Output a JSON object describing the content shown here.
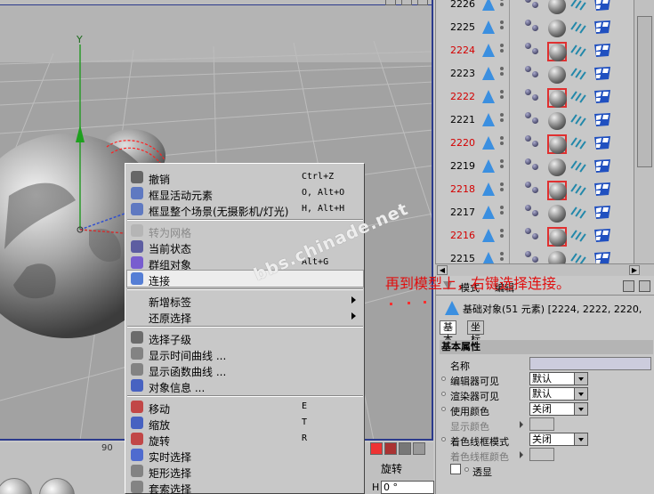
{
  "viewport": {
    "axis_y_label": "Y",
    "coord_readout": "90"
  },
  "object_list": {
    "rows": [
      {
        "num": "2226",
        "red": false,
        "selected": false
      },
      {
        "num": "2225",
        "red": false,
        "selected": false
      },
      {
        "num": "2224",
        "red": true,
        "selected": true
      },
      {
        "num": "2223",
        "red": false,
        "selected": false
      },
      {
        "num": "2222",
        "red": true,
        "selected": true
      },
      {
        "num": "2221",
        "red": false,
        "selected": false
      },
      {
        "num": "2220",
        "red": true,
        "selected": true
      },
      {
        "num": "2219",
        "red": false,
        "selected": false
      },
      {
        "num": "2218",
        "red": true,
        "selected": true
      },
      {
        "num": "2217",
        "red": false,
        "selected": false
      },
      {
        "num": "2216",
        "red": true,
        "selected": true
      },
      {
        "num": "2215",
        "red": false,
        "selected": false
      }
    ]
  },
  "context_menu": {
    "items": [
      {
        "label": "撤销",
        "shortcut": "Ctrl+Z",
        "icon": "undo-icon",
        "dim": false,
        "submenu": false
      },
      {
        "label": "框显活动元素",
        "shortcut": "O, Alt+O",
        "icon": "frame-active-icon",
        "dim": false,
        "submenu": false
      },
      {
        "label": "框显整个场景(无摄影机/灯光)",
        "shortcut": "H, Alt+H",
        "icon": "frame-scene-icon",
        "dim": false,
        "submenu": false
      },
      {
        "label": "转为网格",
        "shortcut": "",
        "icon": "convert-mesh-icon",
        "dim": true,
        "submenu": false
      },
      {
        "label": "当前状态",
        "shortcut": "",
        "icon": "current-state-icon",
        "dim": false,
        "submenu": false
      },
      {
        "label": "群组对象",
        "shortcut": "Alt+G",
        "icon": "group-icon",
        "dim": false,
        "submenu": false
      },
      {
        "label": "连接",
        "shortcut": "",
        "icon": "connect-icon",
        "dim": false,
        "submenu": false,
        "highlight": true
      },
      {
        "label": "新增标签",
        "shortcut": "",
        "icon": "",
        "dim": false,
        "submenu": true
      },
      {
        "label": "还原选择",
        "shortcut": "",
        "icon": "",
        "dim": false,
        "submenu": true
      },
      {
        "label": "选择子级",
        "shortcut": "",
        "icon": "select-children-icon",
        "dim": false,
        "submenu": false
      },
      {
        "label": "显示时间曲线 ...",
        "shortcut": "",
        "icon": "time-curve-icon",
        "dim": false,
        "submenu": false
      },
      {
        "label": "显示函数曲线 ...",
        "shortcut": "",
        "icon": "function-curve-icon",
        "dim": false,
        "submenu": false
      },
      {
        "label": "对象信息 ...",
        "shortcut": "",
        "icon": "object-info-icon",
        "dim": false,
        "submenu": false
      },
      {
        "label": "移动",
        "shortcut": "E",
        "icon": "move-icon",
        "dim": false,
        "submenu": false
      },
      {
        "label": "缩放",
        "shortcut": "T",
        "icon": "scale-icon",
        "dim": false,
        "submenu": false
      },
      {
        "label": "旋转",
        "shortcut": "R",
        "icon": "rotate-icon",
        "dim": false,
        "submenu": false
      },
      {
        "label": "实时选择",
        "shortcut": "",
        "icon": "live-select-icon",
        "dim": false,
        "submenu": false
      },
      {
        "label": "矩形选择",
        "shortcut": "",
        "icon": "rect-select-icon",
        "dim": false,
        "submenu": false
      },
      {
        "label": "套索选择",
        "shortcut": "",
        "icon": "lasso-select-icon",
        "dim": false,
        "submenu": false
      }
    ]
  },
  "attributes": {
    "tabs": {
      "mode": "模式",
      "edit": "编辑"
    },
    "object_header": "基础对象(51 元素) [2224, 2222, 2220,",
    "sub_tabs": {
      "basic": "基本",
      "coord": "坐标"
    },
    "section_title": "基本属性",
    "props": {
      "name": {
        "label": "名称",
        "value": ""
      },
      "editor_visible": {
        "label": "编辑器可见",
        "value": "默认"
      },
      "render_visible": {
        "label": "渲染器可见",
        "value": "默认"
      },
      "use_color": {
        "label": "使用颜色",
        "value": "关闭"
      },
      "display_color": {
        "label": "显示颜色"
      },
      "wire_color_mode": {
        "label": "着色线框模式",
        "value": "关闭"
      },
      "wire_color": {
        "label": "着色线框颜色"
      },
      "xray": {
        "label": "透显"
      }
    }
  },
  "bottom": {
    "rotate_label": "旋转",
    "h_label": "H",
    "h_value": "0 °"
  },
  "annotation": "再到模型上，右键选择连接。",
  "watermark": "bbs.chinade.net",
  "colors": {
    "red_text": "#d40000",
    "annotation_red": "#e01010",
    "accent_blue": "#3b8fe0"
  }
}
